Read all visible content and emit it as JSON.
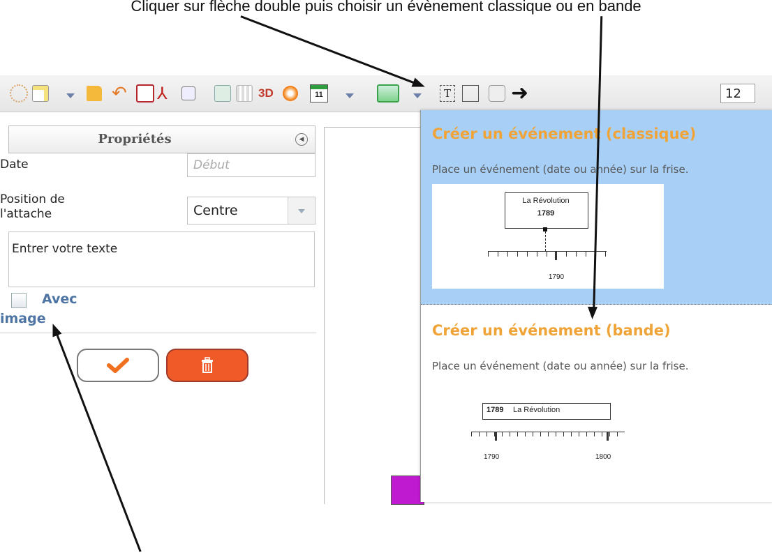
{
  "caption": "Cliquer sur flèche double puis choisir un évènement classique ou en bande",
  "toolbar": {
    "icons": [
      "globe-icon",
      "new-doc-icon",
      "caret-icon",
      "open-folder-icon",
      "undo-icon",
      "save-icon",
      "pdf-icon",
      "image-export-icon",
      "chart-icon",
      "columns-icon",
      "3d-icon",
      "color-wheel-icon",
      "calendar-event-icon",
      "caret-icon",
      "landscape-icon",
      "caret-icon",
      "text-box-icon",
      "frame-icon",
      "camera-icon",
      "arrow-icon"
    ],
    "label_3d": "3D",
    "calendar_day": "11",
    "font_size": "12"
  },
  "panel": {
    "title": "Propriétés",
    "date_label": "Date",
    "date_placeholder": "Début",
    "attach_label_1": "Position de",
    "attach_label_2": "l'attache",
    "attach_value": "Centre",
    "text_value": "Entrer votre texte",
    "image_label_1": "Avec",
    "image_label_2": "image"
  },
  "menu": {
    "classic_title": "Créer un événement (classique)",
    "classic_desc": "Place un événement (date ou année) sur la frise.",
    "classic_illus_name": "La Révolution",
    "classic_illus_year": "1789",
    "classic_illus_axis": "1790",
    "band_title": "Créer un événement (bande)",
    "band_desc": "Place un événement (date ou année) sur la frise.",
    "band_illus_year": "1789",
    "band_illus_name": "La Révolution",
    "band_illus_axis_1": "1790",
    "band_illus_axis_2": "1800"
  },
  "colors": {
    "menu_highlight": "#a8d0f7",
    "menu_title": "#f0a438",
    "delete_button": "#f05a28",
    "checkbox_label": "#4d74a3"
  }
}
